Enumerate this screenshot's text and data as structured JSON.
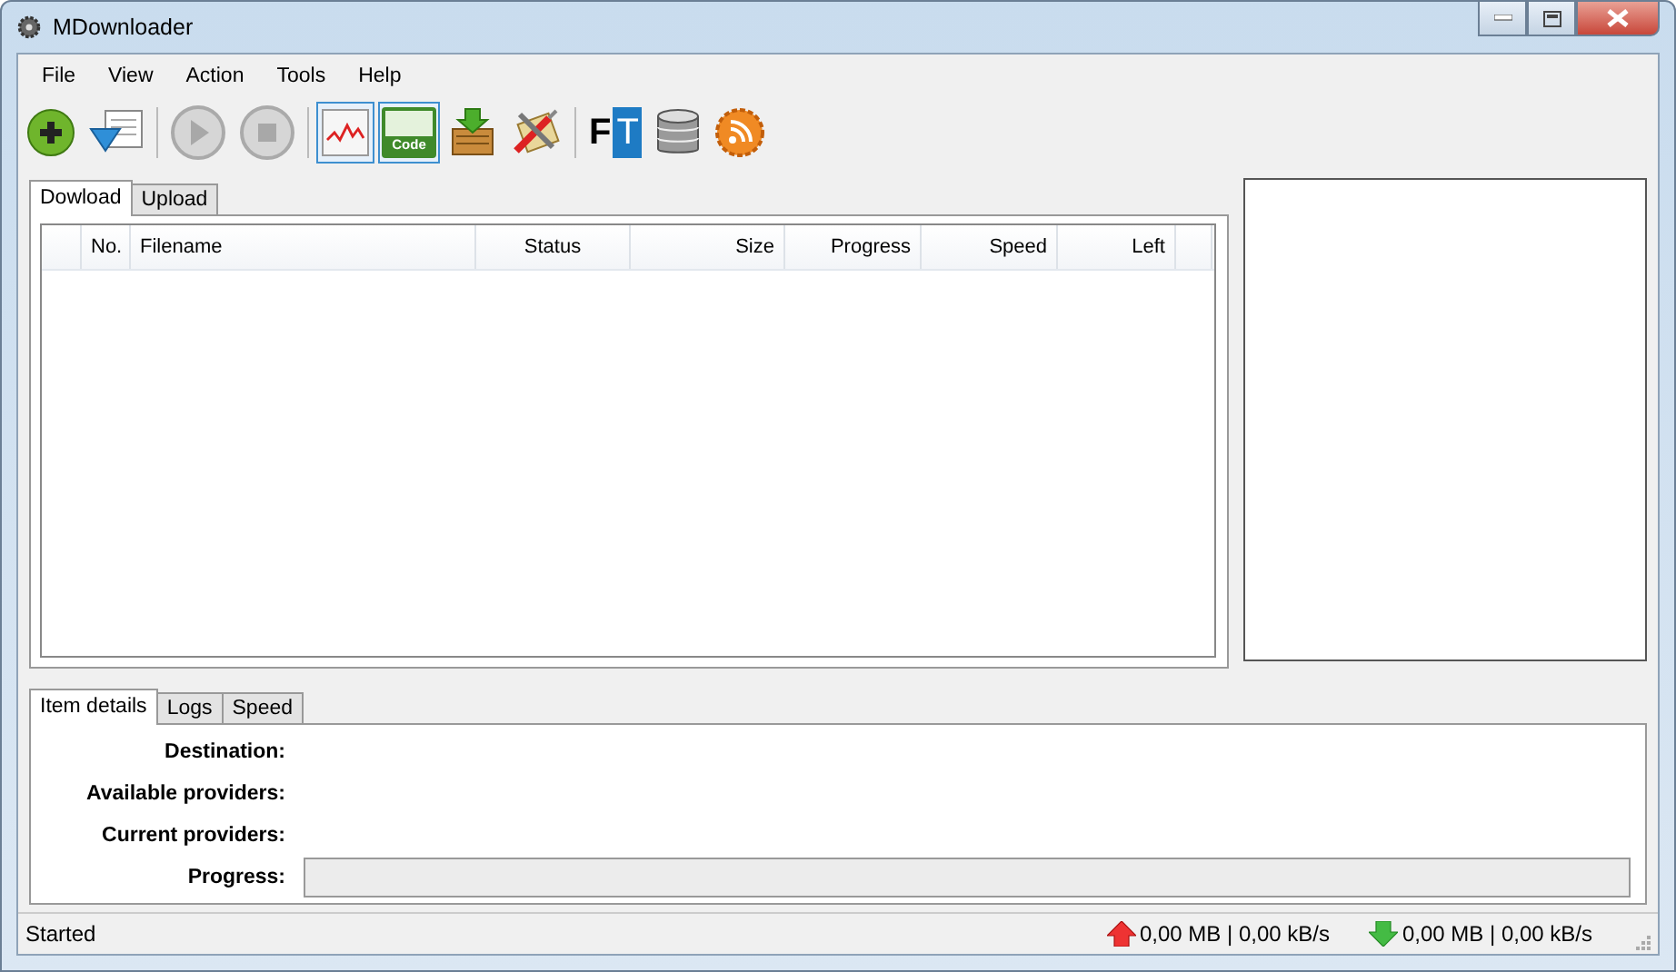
{
  "window": {
    "title": "MDownloader"
  },
  "menu": [
    "File",
    "View",
    "Action",
    "Tools",
    "Help"
  ],
  "toolbar": [
    {
      "kind": "add",
      "selected": false
    },
    {
      "kind": "import",
      "selected": false
    },
    {
      "kind": "separator"
    },
    {
      "kind": "play",
      "disabled": true,
      "selected": false
    },
    {
      "kind": "stop",
      "disabled": true,
      "selected": false
    },
    {
      "kind": "separator"
    },
    {
      "kind": "graph",
      "selected": true
    },
    {
      "kind": "code",
      "selected": true,
      "text": "Code"
    },
    {
      "kind": "install",
      "selected": false
    },
    {
      "kind": "tools",
      "selected": false
    },
    {
      "kind": "separator"
    },
    {
      "kind": "ft",
      "selected": false,
      "letters": [
        "F",
        "T"
      ]
    },
    {
      "kind": "database",
      "selected": false
    },
    {
      "kind": "rss",
      "selected": false
    }
  ],
  "main_tabs": [
    {
      "label": "Dowload",
      "selected": true
    },
    {
      "label": "Upload",
      "selected": false
    }
  ],
  "table": {
    "columns": [
      {
        "label": "No."
      },
      {
        "label": "Filename"
      },
      {
        "label": "Status"
      },
      {
        "label": "Size"
      },
      {
        "label": "Progress"
      },
      {
        "label": "Speed"
      },
      {
        "label": "Left"
      }
    ]
  },
  "detail_tabs": [
    {
      "label": "Item details",
      "selected": true
    },
    {
      "label": "Logs",
      "selected": false
    },
    {
      "label": "Speed",
      "selected": false
    }
  ],
  "details": [
    {
      "label": "Destination:",
      "kind": "text"
    },
    {
      "label": "Available providers:",
      "kind": "text"
    },
    {
      "label": "Current providers:",
      "kind": "text"
    },
    {
      "label": "Progress:",
      "kind": "bar",
      "level": 0
    }
  ],
  "status_bar": {
    "text": "Started",
    "upload": "0,00 MB | 0,00 kB/s",
    "download": "0,00 MB | 0,00 kB/s"
  }
}
